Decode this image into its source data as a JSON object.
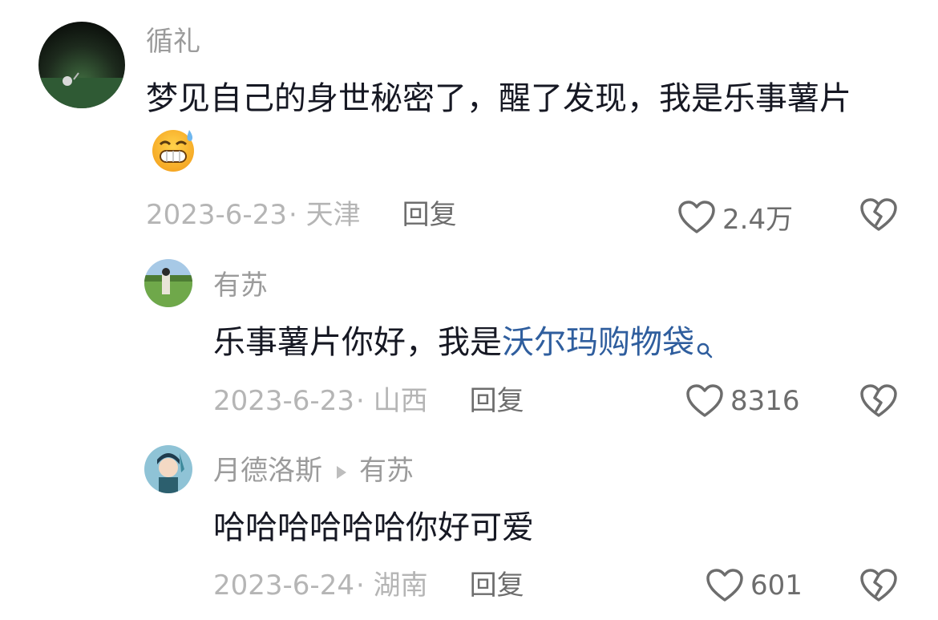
{
  "comments": [
    {
      "username": "循礼",
      "text": "梦见自己的身世秘密了，醒了发现，我是乐事薯片",
      "date": "2023-6-23",
      "location": "· 天津",
      "reply_label": "回复",
      "likes": "2.4万"
    },
    {
      "username": "有苏",
      "text_prefix": "乐事薯片你好，我是",
      "link_text": "沃尔玛购物袋",
      "date": "2023-6-23",
      "location": "· 山西",
      "reply_label": "回复",
      "likes": "8316"
    },
    {
      "username": "月德洛斯",
      "reply_to": "有苏",
      "text": "哈哈哈哈哈哈你好可爱",
      "date": "2023-6-24",
      "location": "· 湖南",
      "reply_label": "回复",
      "likes": "601"
    }
  ],
  "icons": {
    "like": "heart-outline-icon",
    "dislike": "broken-heart-icon",
    "search": "search-icon",
    "emoji": "grinning-sweat-emoji"
  },
  "colors": {
    "text": "#161823",
    "muted": "#9b9b9b",
    "link": "#2f5e9e"
  }
}
